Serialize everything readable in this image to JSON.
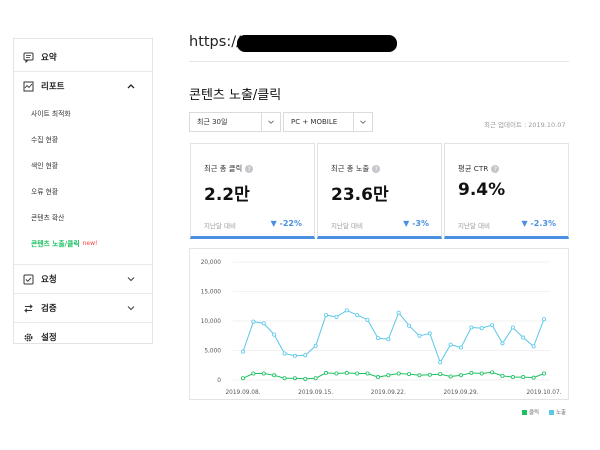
{
  "sidebar": {
    "summary": "요약",
    "report": "리포트",
    "report_items": [
      {
        "label": "사이트 최적화"
      },
      {
        "label": "수집 현황"
      },
      {
        "label": "색인 현황"
      },
      {
        "label": "오류 현황"
      },
      {
        "label": "콘텐츠 확산"
      }
    ],
    "active_item": "콘텐츠 노출/클릭",
    "active_badge": "new!",
    "request": "요청",
    "verify": "검증",
    "settings": "설정"
  },
  "url_prefix": "https://",
  "page_title": "콘텐츠 노출/클릭",
  "filters": {
    "period": "최근 30일",
    "device": "PC + MOBILE",
    "updated": "최근 업데이트 : 2019.10.07"
  },
  "cards": [
    {
      "label": "최근 총 클릭",
      "value": "2.2만",
      "compare": "지난달 대비",
      "delta": "▼ -22%"
    },
    {
      "label": "최근 총 노출",
      "value": "23.6만",
      "compare": "지난달 대비",
      "delta": "▼ -3%"
    },
    {
      "label": "평균 CTR",
      "value": "9.4%",
      "compare": "지난달 대비",
      "delta": "▼ -2.3%"
    }
  ],
  "colors": {
    "accent": "#4a90e2",
    "click": "#1bc161",
    "impression": "#5bc8e8"
  },
  "chart_data": {
    "type": "line",
    "y_ticks": [
      "20,000",
      "15,000",
      "10,000",
      "5,000",
      "0"
    ],
    "ylim": [
      0,
      20000
    ],
    "x_tick_labels": [
      "2019.09.08.",
      "2019.09.15.",
      "2019.09.22.",
      "2019.09.29.",
      "2019.10.07."
    ],
    "x_tick_index": [
      0,
      7,
      14,
      21,
      29
    ],
    "series": [
      {
        "name": "클릭",
        "color": "#1bc161",
        "values": [
          300,
          1100,
          1100,
          800,
          300,
          300,
          200,
          300,
          1200,
          1100,
          1200,
          1100,
          1100,
          500,
          800,
          1100,
          1000,
          800,
          900,
          1000,
          600,
          800,
          1200,
          1100,
          1300,
          700,
          500,
          500,
          400,
          1100
        ]
      },
      {
        "name": "노출",
        "color": "#5bc8e8",
        "values": [
          4800,
          9900,
          9600,
          7700,
          4500,
          4100,
          4200,
          5800,
          11000,
          10700,
          11800,
          11000,
          10200,
          7100,
          6900,
          11400,
          9200,
          7500,
          7900,
          3000,
          6000,
          5500,
          8900,
          8800,
          9300,
          6200,
          8900,
          7200,
          5700,
          10300
        ]
      }
    ]
  }
}
